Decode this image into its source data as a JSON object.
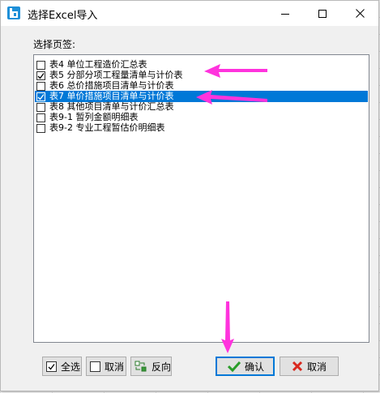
{
  "window": {
    "title": "选择Excel导入"
  },
  "section_label": "选择页签:",
  "sheets": [
    {
      "label": "表4 单位工程造价汇总表",
      "checked": false,
      "selected": false
    },
    {
      "label": "表5 分部分项工程量清单与计价表",
      "checked": true,
      "selected": false
    },
    {
      "label": "表6 总价措施项目清单与计价表",
      "checked": false,
      "selected": false
    },
    {
      "label": "表7 单价措施项目清单与计价表",
      "checked": true,
      "selected": true
    },
    {
      "label": "表8 其他项目清单与计价汇总表",
      "checked": false,
      "selected": false
    },
    {
      "label": "表9-1 暂列金额明细表",
      "checked": false,
      "selected": false
    },
    {
      "label": "表9-2 专业工程暂估价明细表",
      "checked": false,
      "selected": false
    }
  ],
  "buttons": {
    "select_all": "全选",
    "deselect": "取消",
    "invert": "反向",
    "confirm": "确认",
    "cancel": "取消"
  },
  "colors": {
    "selection": "#0078d7",
    "annotation_arrow": "#ff33dd",
    "confirm_check": "#2a9d2a",
    "cancel_x": "#d9281e"
  }
}
